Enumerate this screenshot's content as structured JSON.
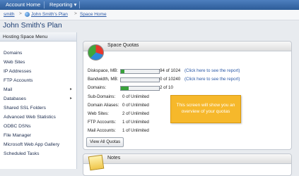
{
  "topnav": {
    "account_home": "Account Home",
    "reporting": "Reporting",
    "reporting_arrow": "▾"
  },
  "breadcrumb": {
    "items": [
      "smith",
      "John Smith's Plan",
      "Space Home"
    ],
    "separator": ">"
  },
  "page_title": "John Smith's Plan",
  "sidebar": {
    "header": "Hosting Space Menu",
    "items": [
      {
        "label": "Domains",
        "has_submenu": false
      },
      {
        "label": "Web Sites",
        "has_submenu": false
      },
      {
        "label": "IP Addresses",
        "has_submenu": false
      },
      {
        "label": "FTP Accounts",
        "has_submenu": false
      },
      {
        "label": "Mail",
        "has_submenu": true
      },
      {
        "label": "Databases",
        "has_submenu": true
      },
      {
        "label": "Shared SSL Folders",
        "has_submenu": false
      },
      {
        "label": "Advanced Web Statistics",
        "has_submenu": false
      },
      {
        "label": "ODBC DSNs",
        "has_submenu": false
      },
      {
        "label": "File Manager",
        "has_submenu": false
      },
      {
        "label": "Microsoft Web App Gallery",
        "has_submenu": false
      },
      {
        "label": "Scheduled Tasks",
        "has_submenu": false
      }
    ],
    "submenu_arrow": "▸"
  },
  "quotas": {
    "title": "Space Quotas",
    "rows": [
      {
        "label": "Diskspace, MB:",
        "value": "94 of 1024",
        "link": "(Click here to see the report)",
        "fill": 0.09
      },
      {
        "label": "Bandwidth, MB:",
        "value": "0 of 10240",
        "link": "(Click here to see the report)",
        "fill": 0.0
      },
      {
        "label": "Domains:",
        "value": "2 of 10",
        "link": "",
        "fill": 0.2
      },
      {
        "label": "Sub-Domains:",
        "value": "0 of Unlimited"
      },
      {
        "label": "Domain Aliases:",
        "value": "0 of Unlimited"
      },
      {
        "label": "Web Sites:",
        "value": "2 of Unlimited"
      },
      {
        "label": "FTP Accounts:",
        "value": "1 of Unlimited"
      },
      {
        "label": "Mail Accounts:",
        "value": "1 of Unlimited"
      }
    ],
    "button": "View All Quotas"
  },
  "tooltip": {
    "line1": "This screen will show you an",
    "line2": "overview of your quotas"
  },
  "notes": {
    "title": "Notes"
  },
  "colors": {
    "accent": "#2d5c98",
    "bar_fill": "#38a13a",
    "tooltip": "#f6b82b"
  }
}
